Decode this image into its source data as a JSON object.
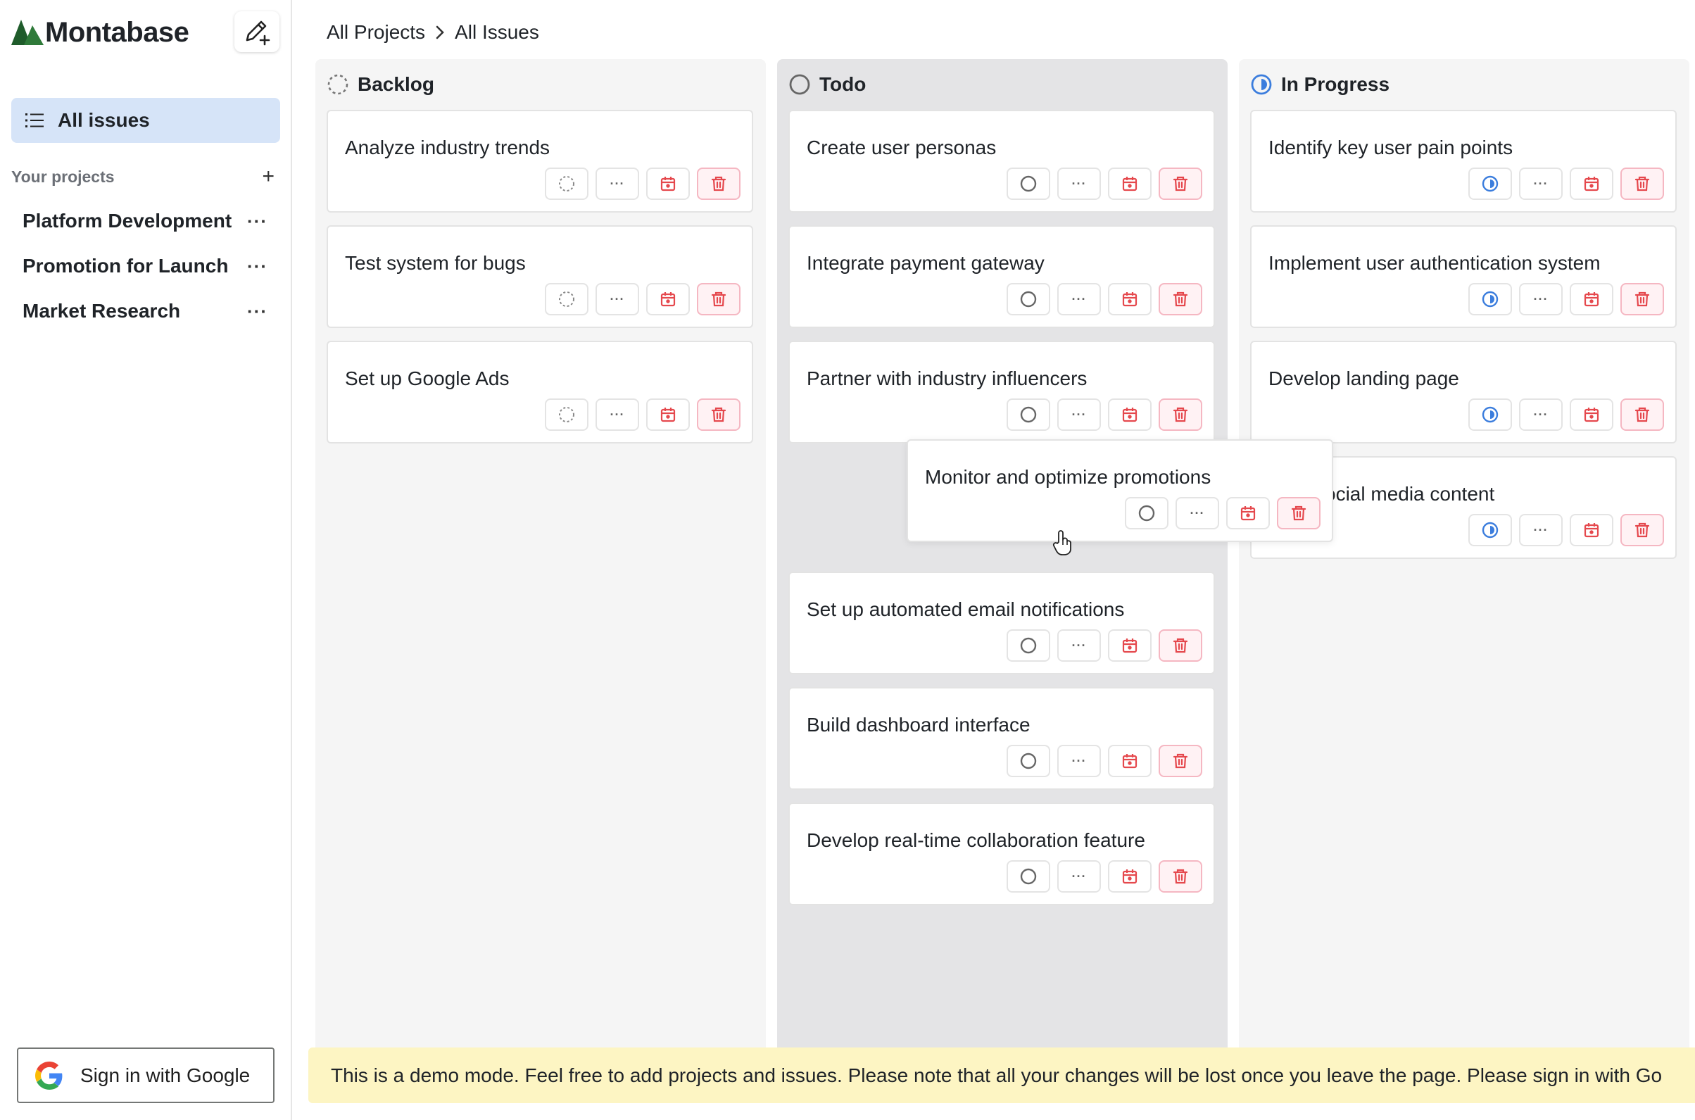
{
  "app": {
    "name": "Montabase"
  },
  "sidebar": {
    "all_issues_label": "All issues",
    "projects_header": "Your projects",
    "add_icon": "+",
    "projects": [
      {
        "label": "Platform Development",
        "menu": "···"
      },
      {
        "label": "Promotion for Launch",
        "menu": "···"
      },
      {
        "label": "Market Research",
        "menu": "···"
      }
    ],
    "google_button": "Sign in with Google"
  },
  "breadcrumb": {
    "root": "All Projects",
    "current": "All Issues"
  },
  "columns": {
    "backlog": {
      "title": "Backlog",
      "status_icon": "dashed-circle-icon",
      "cards": [
        "Analyze industry trends",
        "Test system for bugs",
        "Set up Google Ads"
      ]
    },
    "todo": {
      "title": "Todo",
      "status_icon": "empty-circle-icon",
      "cards": [
        "Create user personas",
        "Integrate payment gateway",
        "Partner with industry influencers",
        "Set up automated email notifications",
        "Build dashboard interface",
        "Develop real-time collaboration feature"
      ]
    },
    "in_progress": {
      "title": "In Progress",
      "status_icon": "half-circle-icon",
      "cards": [
        "Identify key user pain points",
        "Implement user authentication system",
        "Develop landing page",
        "social media content"
      ]
    }
  },
  "dragging_card": {
    "title": "Monitor and optimize promotions",
    "status_icon": "empty-circle-icon"
  },
  "card_actions": {
    "menu": "···"
  },
  "banner": {
    "text": "This is a demo mode. Feel free to add projects and issues. Please note that all your changes will be lost once you leave the page. Please sign in with Go"
  },
  "colors": {
    "accent_blue": "#3b7ddd",
    "selected_bg": "#d6e4f8",
    "danger": "#e5484d",
    "banner_bg": "#fdf5c3",
    "logo_green": "#1f5c2b"
  }
}
